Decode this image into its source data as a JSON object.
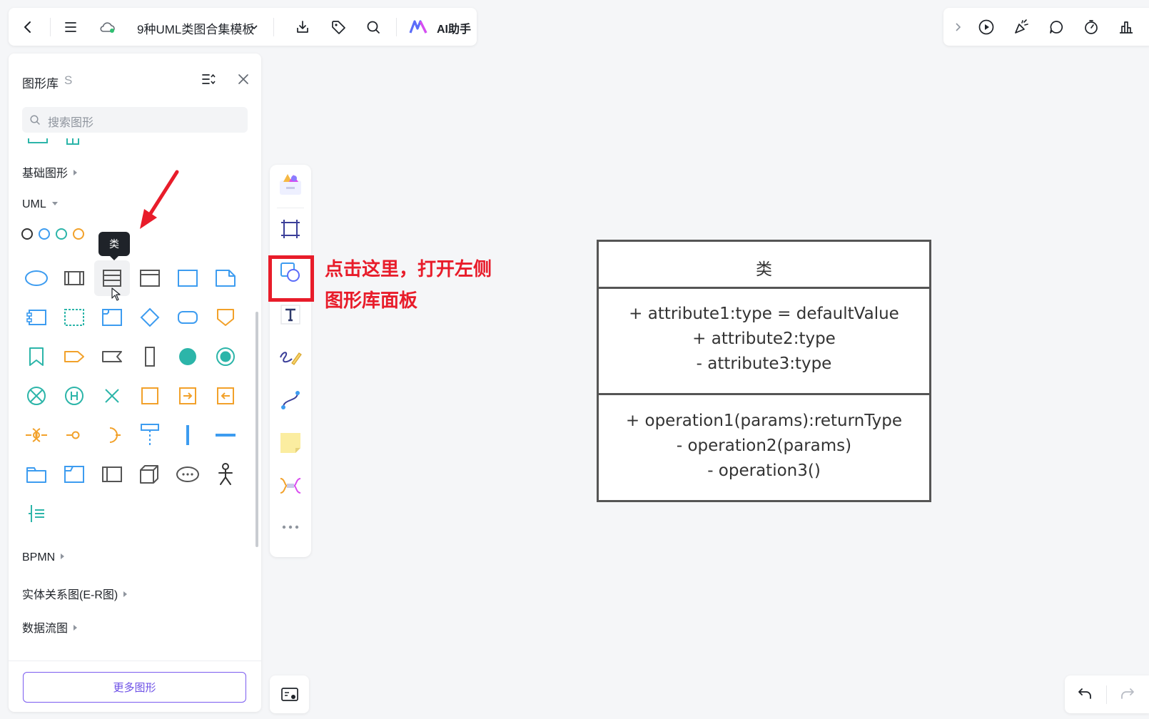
{
  "topbar": {
    "doc_title": "9种UML类图合集模板",
    "ai_label": "AI助手",
    "icons": [
      "back-arrow-icon",
      "menu-icon",
      "cloud-icon",
      "chevron-down-icon",
      "download-icon",
      "tag-icon",
      "search-icon",
      "ai-logo-icon"
    ]
  },
  "rightbar": {
    "icons": [
      "chevron-right-icon",
      "play-icon",
      "celebrate-icon",
      "comment-icon",
      "timer-icon",
      "chart-icon"
    ]
  },
  "library": {
    "title": "图形库",
    "hotkey": "S",
    "search_placeholder": "搜索图形",
    "sections": {
      "basic": "基础图形",
      "uml": "UML",
      "bpmn": "BPMN",
      "er": "实体关系图(E-R图)",
      "dataflow": "数据流图"
    },
    "swatch_colors": [
      "#333333",
      "#3d9cf0",
      "#2cb5a9",
      "#f2a12a"
    ],
    "tooltip": "类",
    "more_button": "更多图形"
  },
  "annotation": {
    "line1": "点击这里，打开左侧",
    "line2": "图形库面板",
    "color": "#e81c2a"
  },
  "uml_class": {
    "name": "类",
    "attributes": [
      "+ attribute1:type = defaultValue",
      "+ attribute2:type",
      "- attribute3:type"
    ],
    "operations": [
      "+ operation1(params):returnType",
      "- operation2(params)",
      "- operation3()"
    ]
  }
}
